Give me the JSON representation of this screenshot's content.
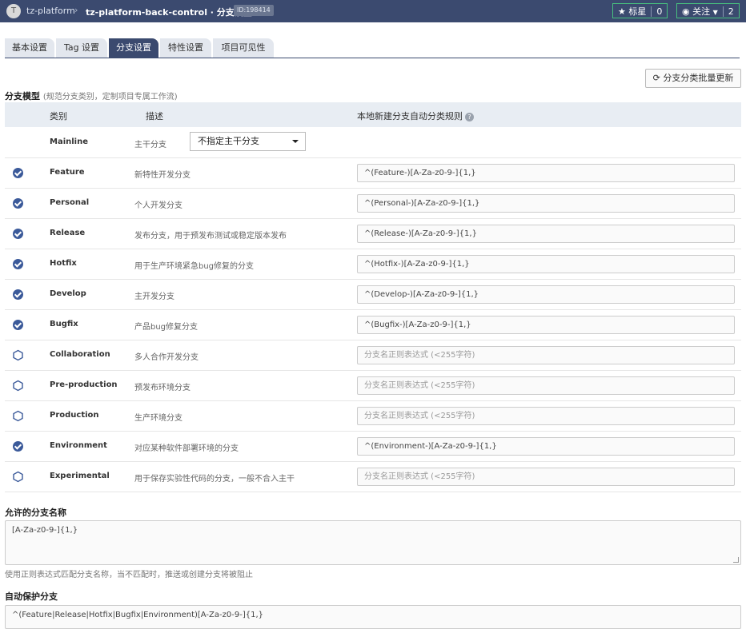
{
  "header": {
    "logo_letter": "T",
    "crumb_group": "tz-platform",
    "crumb_sep": "›",
    "project_title": "tz-platform-back-control · 分支设置",
    "id_badge": "ID:198414",
    "star": {
      "icon": "★",
      "label": "标星",
      "count": "0"
    },
    "watch": {
      "icon": "◉",
      "label": "关注",
      "count": "2"
    }
  },
  "tabs": [
    {
      "label": "基本设置",
      "active": false
    },
    {
      "label": "Tag 设置",
      "active": false
    },
    {
      "label": "分支设置",
      "active": true
    },
    {
      "label": "特性设置",
      "active": false
    },
    {
      "label": "项目可见性",
      "active": false
    }
  ],
  "batch_update_button": "分支分类批量更新",
  "branch_model": {
    "title": "分支模型",
    "subtitle": "(规范分支类别，定制项目专属工作流)",
    "columns": {
      "category": "类别",
      "description": "描述",
      "rule": "本地新建分支自动分类规则"
    },
    "mainline": {
      "category": "Mainline",
      "description": "主干分支",
      "select_value": "不指定主干分支"
    },
    "rows": [
      {
        "checked": true,
        "category": "Feature",
        "description": "新特性开发分支",
        "rule": "^(Feature-)[A-Za-z0-9-]{1,}"
      },
      {
        "checked": true,
        "category": "Personal",
        "description": "个人开发分支",
        "rule": "^(Personal-)[A-Za-z0-9-]{1,}"
      },
      {
        "checked": true,
        "category": "Release",
        "description": "发布分支，用于预发布测试或稳定版本发布",
        "rule": "^(Release-)[A-Za-z0-9-]{1,}"
      },
      {
        "checked": true,
        "category": "Hotfix",
        "description": "用于生产环境紧急bug修复的分支",
        "rule": "^(Hotfix-)[A-Za-z0-9-]{1,}"
      },
      {
        "checked": true,
        "category": "Develop",
        "description": "主开发分支",
        "rule": "^(Develop-)[A-Za-z0-9-]{1,}"
      },
      {
        "checked": true,
        "category": "Bugfix",
        "description": "产品bug修复分支",
        "rule": "^(Bugfix-)[A-Za-z0-9-]{1,}"
      },
      {
        "checked": false,
        "category": "Collaboration",
        "description": "多人合作开发分支",
        "rule": "",
        "placeholder": "分支名正则表达式 (<255字符)"
      },
      {
        "checked": false,
        "category": "Pre-production",
        "description": "预发布环境分支",
        "rule": "",
        "placeholder": "分支名正则表达式 (<255字符)"
      },
      {
        "checked": false,
        "category": "Production",
        "description": "生产环境分支",
        "rule": "",
        "placeholder": "分支名正则表达式 (<255字符)"
      },
      {
        "checked": true,
        "category": "Environment",
        "description": "对应某种软件部署环境的分支",
        "rule": "^(Environment-)[A-Za-z0-9-]{1,}"
      },
      {
        "checked": false,
        "category": "Experimental",
        "description": "用于保存实验性代码的分支，一般不合入主干",
        "rule": "",
        "placeholder": "分支名正则表达式 (<255字符)"
      }
    ]
  },
  "allowed_names": {
    "title": "允许的分支名称",
    "value": "[A-Za-z0-9-]{1,}",
    "help": "使用正则表达式匹配分支名称，当不匹配时，推送或创建分支将被阻止"
  },
  "auto_protect": {
    "title": "自动保护分支",
    "value": "^(Feature|Release|Hotfix|Bugfix|Environment)[A-Za-z0-9-]{1,}"
  },
  "colors": {
    "header_bg": "#3b4a6f",
    "accent_green": "#48c07e",
    "check_blue": "#3b5a9a"
  }
}
